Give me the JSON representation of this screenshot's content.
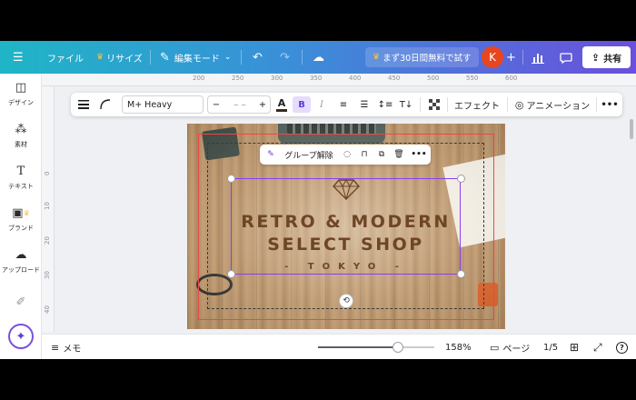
{
  "header": {
    "file_label": "ファイル",
    "resize_label": "リサイズ",
    "edit_mode_label": "編集モード",
    "trial_label": "まず30日間無料で試す",
    "avatar_initial": "K",
    "share_label": "共有"
  },
  "sidebar": {
    "items": [
      {
        "label": "デザイン",
        "icon": "layout-icon"
      },
      {
        "label": "素材",
        "icon": "elements-icon"
      },
      {
        "label": "テキスト",
        "icon": "text-icon"
      },
      {
        "label": "ブランド",
        "icon": "brand-icon"
      },
      {
        "label": "アップロード",
        "icon": "upload-icon"
      }
    ]
  },
  "ruler": {
    "top_ticks": [
      "200",
      "250",
      "300",
      "350",
      "400",
      "450",
      "500",
      "550",
      "600"
    ],
    "left_ticks": [
      "0",
      "10",
      "20",
      "30",
      "40",
      "50"
    ]
  },
  "toolbar": {
    "font_name": "M+ Heavy",
    "size_value": "– –",
    "effect_label": "エフェクト",
    "animation_label": "アニメーション",
    "text_color": "#3b2a1a"
  },
  "context_bar": {
    "ungroup_label": "グループ解除"
  },
  "design": {
    "line1": "RETRO & MODERN",
    "line2": "SELECT SHOP",
    "line3": "- TOKYO -",
    "text_color": "#6e4626"
  },
  "bottom": {
    "memo_label": "メモ",
    "zoom_percent": 158,
    "zoom_label": "158%",
    "zoom_slider_fraction": 0.69,
    "page_label": "ページ",
    "page_count": "1/5"
  }
}
